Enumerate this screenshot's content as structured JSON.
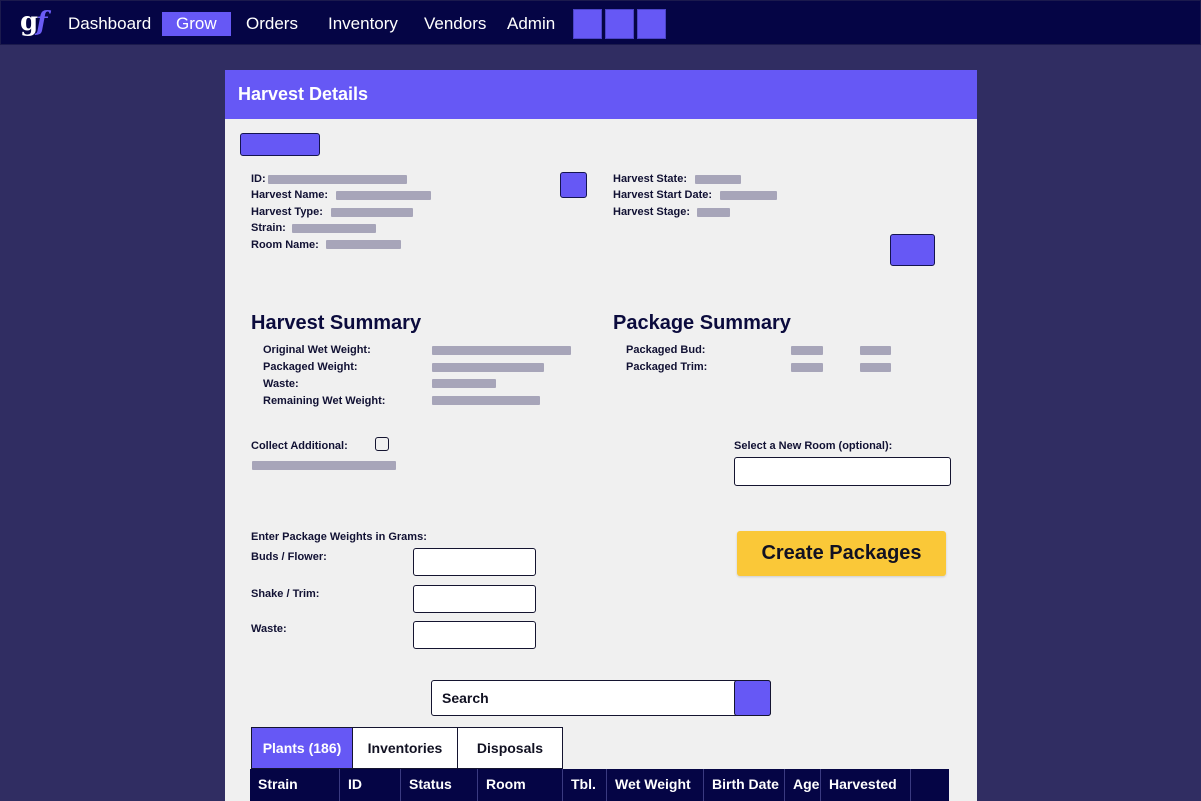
{
  "nav": {
    "logo_g": "g",
    "logo_f": "f",
    "items": [
      "Dashboard",
      "Grow",
      "Orders",
      "Inventory",
      "Vendors",
      "Admin"
    ],
    "active": "Grow"
  },
  "panel": {
    "title": "Harvest Details"
  },
  "details_left": {
    "id_label": "ID:",
    "name_label": "Harvest Name:",
    "type_label": "Harvest Type:",
    "strain_label": "Strain:",
    "room_label": "Room Name:"
  },
  "details_right": {
    "state_label": "Harvest State:",
    "start_label": "Harvest Start Date:",
    "stage_label": "Harvest Stage:"
  },
  "harvest_summary": {
    "title": "Harvest Summary",
    "original_label": "Original Wet Weight:",
    "packaged_label": "Packaged Weight:",
    "waste_label": "Waste:",
    "remaining_label": "Remaining Wet Weight:"
  },
  "package_summary": {
    "title": "Package Summary",
    "bud_label": "Packaged Bud:",
    "trim_label": "Packaged Trim:"
  },
  "collect": {
    "label": "Collect Additional:"
  },
  "room_select": {
    "label": "Select a New Room (optional):"
  },
  "weights": {
    "heading": "Enter Package Weights in Grams:",
    "buds_label": "Buds / Flower:",
    "shake_label": "Shake / Trim:",
    "waste_label": "Waste:"
  },
  "create_button": "Create Packages",
  "search": {
    "label": "Search"
  },
  "tabs": [
    "Plants (186)",
    "Inventories",
    "Disposals"
  ],
  "active_tab": "Plants (186)",
  "table": {
    "columns": [
      "Strain",
      "ID",
      "Status",
      "Room",
      "Tbl.",
      "Wet Weight",
      "Birth Date",
      "Age",
      "Harvested"
    ]
  },
  "colors": {
    "nav_bg": "#050545",
    "page_bg": "#302d62",
    "accent": "#6658f5",
    "panel_bg": "#f0f0f0",
    "cta": "#fac838",
    "placeholder_bar": "#a7a5b9"
  }
}
